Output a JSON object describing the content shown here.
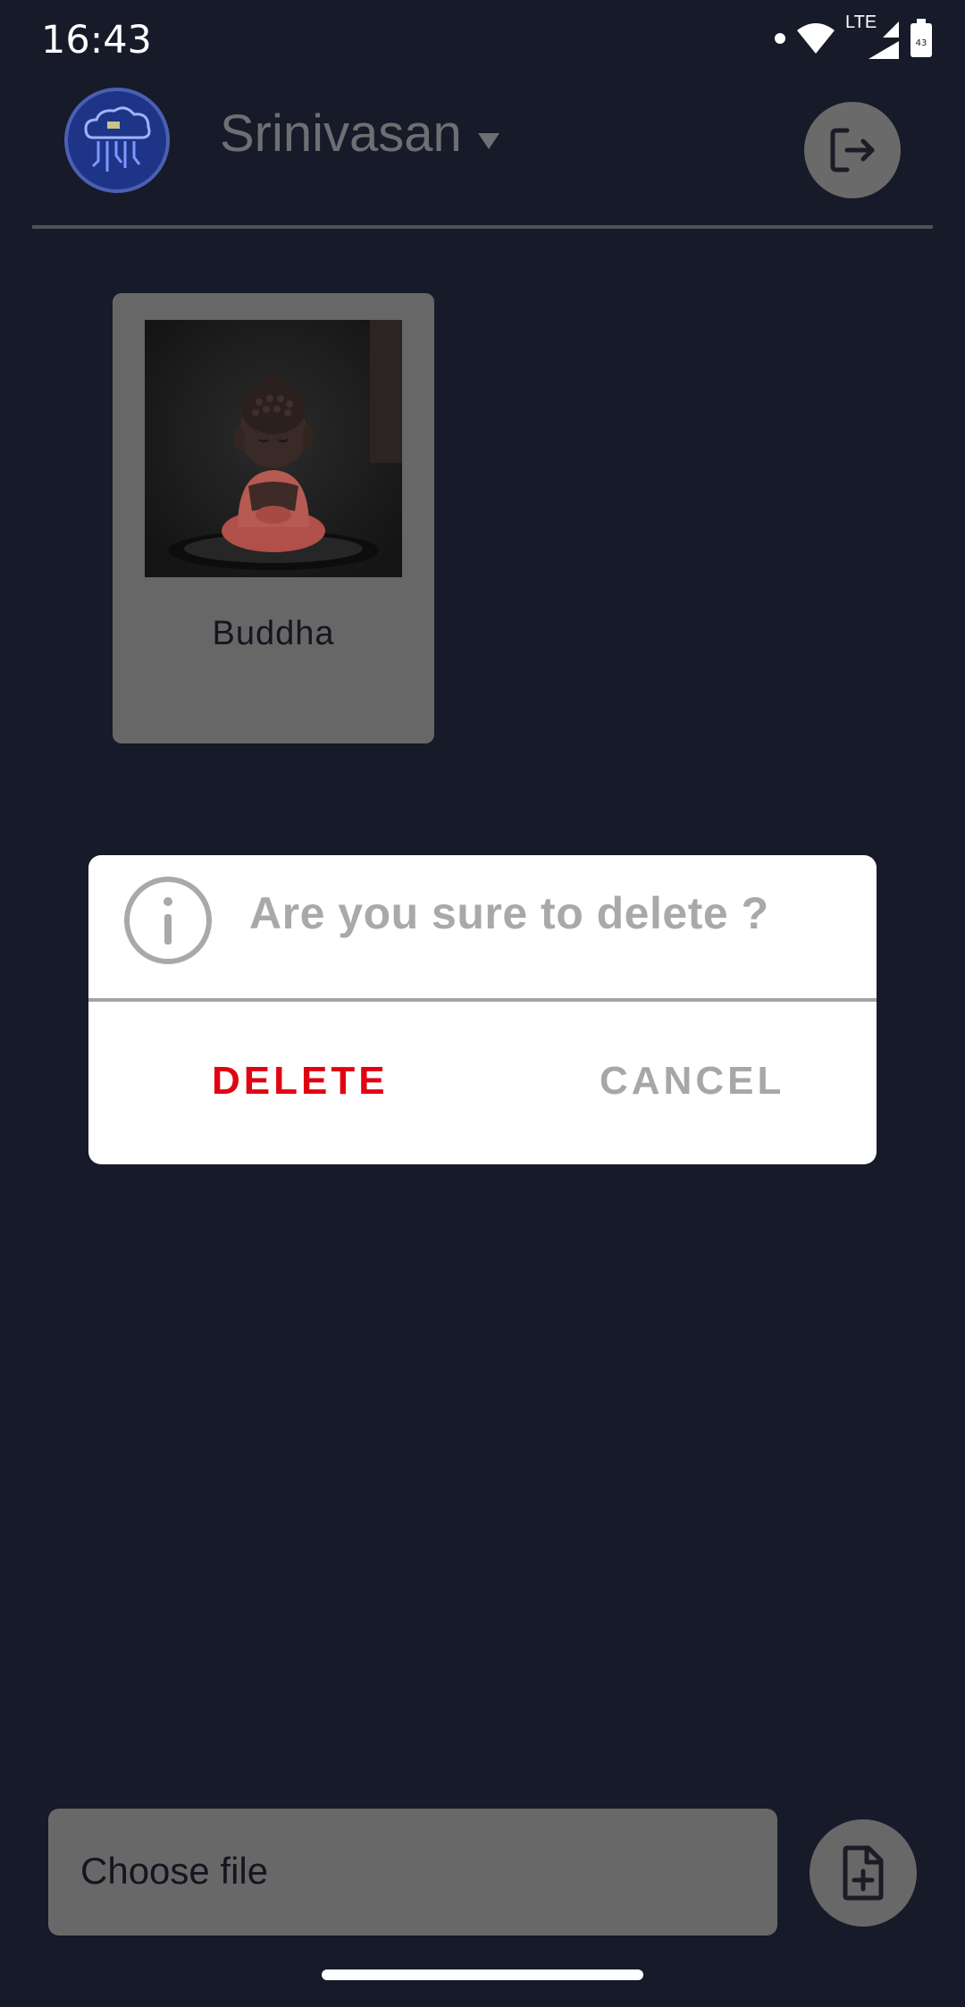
{
  "status_bar": {
    "time": "16:43",
    "network": "LTE",
    "icons": [
      "dot-indicator-icon",
      "wifi-icon",
      "signal-icon",
      "battery-icon"
    ]
  },
  "header": {
    "user_name": "Srinivasan",
    "avatar_icon": "cloud-logo-icon",
    "logout_icon": "logout-icon"
  },
  "files": [
    {
      "name": "Buddha",
      "image": "buddha-statue-photo"
    }
  ],
  "dialog": {
    "icon": "info-icon",
    "message": "Are you sure to delete ?",
    "delete_label": "DELETE",
    "cancel_label": "CANCEL"
  },
  "bottom_bar": {
    "choose_file_label": "Choose file",
    "add_file_icon": "add-file-icon"
  },
  "colors": {
    "background": "#171a28",
    "delete": "#e00412",
    "muted": "#a9a9a9",
    "panel": "#686868"
  }
}
